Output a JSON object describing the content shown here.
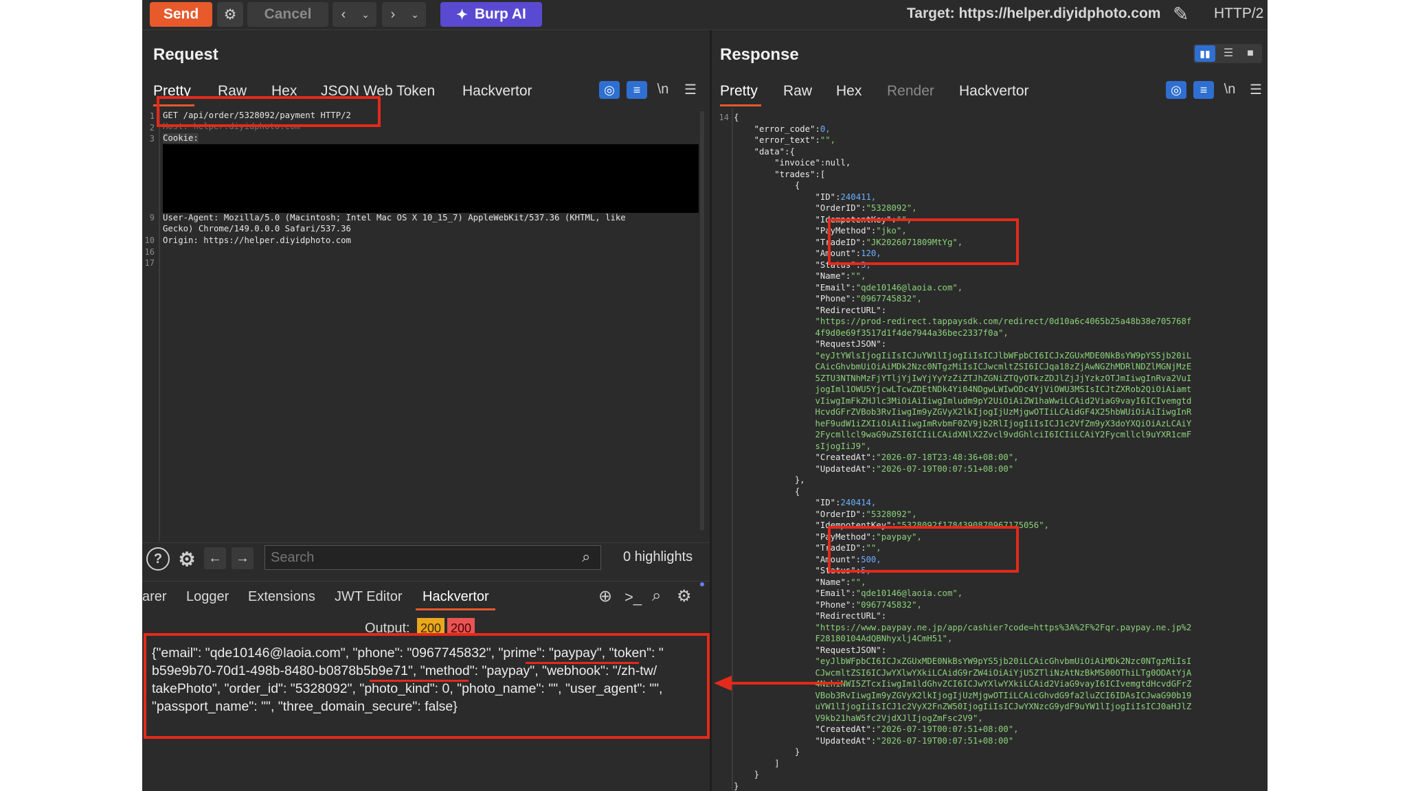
{
  "toolbar": {
    "send": "Send",
    "cancel": "Cancel",
    "burp_ai": "Burp AI",
    "target": "Target: https://helper.diyidphoto.com",
    "protocol": "HTTP/2"
  },
  "request": {
    "title": "Request",
    "tabs": [
      "Pretty",
      "Raw",
      "Hex",
      "JSON Web Token",
      "Hackvertor"
    ],
    "newline_toggle": "\\n",
    "line_numbers": [
      "1",
      "2",
      "3",
      "9",
      "",
      "10",
      "16",
      "17"
    ],
    "lines": {
      "l1": "GET /api/order/5328092/payment HTTP/2",
      "l2": "Host: helper.diyidphoto.com",
      "l3": "Cookie:",
      "l9a": "User-Agent: Mozilla/5.0 (Macintosh; Intel Mac OS X 10_15_7) AppleWebKit/537.36 (KHTML, like",
      "l9b": "Gecko) Chrome/149.0.0.0 Safari/537.36",
      "l10": "Origin: https://helper.diyidphoto.com"
    }
  },
  "search": {
    "placeholder": "Search",
    "highlights": "0 highlights"
  },
  "bottom_tabs": [
    "arer",
    "Logger",
    "Extensions",
    "JWT Editor",
    "Hackvertor"
  ],
  "output": {
    "label": "Output:",
    "badge1": "200",
    "badge2": "200",
    "lines": [
      "{\"email\": \"qde10146@laoia.com\", \"phone\": \"0967745832\", \"prime\": \"paypay\", \"token\": \"",
      "b59e9b70-70d1-498b-8480-b0878b5b9e71\", \"method\": \"paypay\", \"webhook\": \"/zh-tw/",
      "takePhoto\", \"order_id\": \"5328092\", \"photo_kind\": 0, \"photo_name\": \"\", \"user_agent\": \"\",",
      "\"passport_name\": \"\", \"three_domain_secure\": false}"
    ]
  },
  "response": {
    "title": "Response",
    "tabs": [
      "Pretty",
      "Raw",
      "Hex",
      "Render",
      "Hackvertor"
    ],
    "newline_toggle": "\\n",
    "first_line_number": "14",
    "json_lines": [
      {
        "t": "{",
        "c": "p"
      },
      {
        "t": "    \"error_code\":0,",
        "c": "k"
      },
      {
        "t": "    \"error_text\":\"\",",
        "c": "k"
      },
      {
        "t": "    \"data\":{",
        "c": "k"
      },
      {
        "t": "        \"invoice\":null,",
        "c": "k"
      },
      {
        "t": "        \"trades\":[",
        "c": "k"
      },
      {
        "t": "            {",
        "c": "p"
      },
      {
        "t": "                \"ID\":240411,",
        "c": "k"
      },
      {
        "t": "                \"OrderID\":\"5328092\",",
        "c": "k"
      },
      {
        "t": "                \"IdempotentKey\":\"\",",
        "c": "k"
      },
      {
        "t": "                \"PayMethod\":\"jko\",",
        "c": "k"
      },
      {
        "t": "                \"TradeID\":\"JK2026071809MtYg\",",
        "c": "k"
      },
      {
        "t": "                \"Amount\":120,",
        "c": "k"
      },
      {
        "t": "                \"Status\":3,",
        "c": "k"
      },
      {
        "t": "                \"Name\":\"\",",
        "c": "k"
      },
      {
        "t": "                \"Email\":\"qde10146@laoia.com\",",
        "c": "k"
      },
      {
        "t": "                \"Phone\":\"0967745832\",",
        "c": "k"
      },
      {
        "t": "                \"RedirectURL\":",
        "c": "k"
      },
      {
        "t": "                \"https://prod-redirect.tappaysdk.com/redirect/0d10a6c4065b25a48b38e705768f",
        "c": "s"
      },
      {
        "t": "                4f9d0e69f3517d1f4de7944a36bec2337f0a\",",
        "c": "s"
      },
      {
        "t": "                \"RequestJSON\":",
        "c": "k"
      },
      {
        "t": "                \"eyJtYWlsIjogIiIsICJuYW1lIjogIiIsICJlbWFpbCI6ICJxZGUxMDE0NkBsYW9pYS5jb20iL",
        "c": "s"
      },
      {
        "t": "                CAicGhvbmUiOiAiMDk2Nzc0NTgzMiIsICJwcmltZSI6ICJqa18zZjAwNGZhMDRlNDZlMGNjMzE",
        "c": "s"
      },
      {
        "t": "                5ZTU3NTNhMzFjYTljYjIwYjYyYzZiZTJhZGNiZTQyOTkzZDJlZjJjYzkzOTJmIiwgInRva2VuI",
        "c": "s"
      },
      {
        "t": "                jogIml1OWU5YjcwLTcwZDEtNDk4Yi04NDgwLWIwODc4YjViOWU3MSIsICJtZXRob2QiOiAiamt",
        "c": "s"
      },
      {
        "t": "                vIiwgImFkZHJlc3MiOiAiIiwgImludm9pY2UiOiAiZW1haWwiLCAid2ViaG9vayI6ICIvemgtd",
        "c": "s"
      },
      {
        "t": "                HcvdGFrZVBob3RvIiwgIm9yZGVyX2lkIjogIjUzMjgwOTIiLCAidGF4X25hbWUiOiAiIiwgInR",
        "c": "s"
      },
      {
        "t": "                heF9udW1iZXIiOiAiIiwgImRvbmF0ZV9jb2RlIjogIiIsICJ1c2VfZm9yX3doYXQiOiAzLCAiY",
        "c": "s"
      },
      {
        "t": "                2Fycmllcl9waG9uZSI6ICIiLCAidXNlX2Zvcl9vdGhlciI6ICIiLCAiY2Fycmllcl9uYXR1cmF",
        "c": "s"
      },
      {
        "t": "                sIjogIiJ9\",",
        "c": "s"
      },
      {
        "t": "                \"CreatedAt\":\"2026-07-18T23:48:36+08:00\",",
        "c": "k"
      },
      {
        "t": "                \"UpdatedAt\":\"2026-07-19T00:07:51+08:00\"",
        "c": "k"
      },
      {
        "t": "            },",
        "c": "p"
      },
      {
        "t": "            {",
        "c": "p"
      },
      {
        "t": "                \"ID\":240414,",
        "c": "k"
      },
      {
        "t": "                \"OrderID\":\"5328092\",",
        "c": "k"
      },
      {
        "t": "                \"IdempotentKey\":\"5328092f1784390870967175056\",",
        "c": "k"
      },
      {
        "t": "                \"PayMethod\":\"paypay\",",
        "c": "k"
      },
      {
        "t": "                \"TradeID\":\"\",",
        "c": "k"
      },
      {
        "t": "                \"Amount\":500,",
        "c": "k"
      },
      {
        "t": "                \"Status\":5,",
        "c": "k"
      },
      {
        "t": "                \"Name\":\"\",",
        "c": "k"
      },
      {
        "t": "                \"Email\":\"qde10146@laoia.com\",",
        "c": "k"
      },
      {
        "t": "                \"Phone\":\"0967745832\",",
        "c": "k"
      },
      {
        "t": "                \"RedirectURL\":",
        "c": "k"
      },
      {
        "t": "                \"https://www.paypay.ne.jp/app/cashier?code=https%3A%2F%2Fqr.paypay.ne.jp%2",
        "c": "s"
      },
      {
        "t": "                F28180104AdQBNhyxlj4CmH51\",",
        "c": "s"
      },
      {
        "t": "                \"RequestJSON\":",
        "c": "k"
      },
      {
        "t": "                \"eyJlbWFpbCI6ICJxZGUxMDE0NkBsYW9pYS5jb20iLCAicGhvbmUiOiAiMDk2Nzc0NTgzMiIsI",
        "c": "s"
      },
      {
        "t": "                CJwcmltZSI6ICJwYXlwYXkiLCAidG9rZW4iOiAiYjU5ZTliNzAtNzBkMS00OThiLTg0ODAtYjA",
        "c": "s"
      },
      {
        "t": "                4NzhiNWI5ZTcxIiwgIm1ldGhvZCI6ICJwYXlwYXkiLCAid2ViaG9vayI6ICIvemgtdHcvdGFrZ",
        "c": "s"
      },
      {
        "t": "                VBob3RvIiwgIm9yZGVyX2lkIjogIjUzMjgwOTIiLCAicGhvdG9fa2luZCI6IDAsICJwaG90b19",
        "c": "s"
      },
      {
        "t": "                uYW1lIjogIiIsICJ1c2VyX2FnZW50IjogIiIsICJwYXNzcG9ydF9uYW1lIjogIiIsICJ0aHJlZ",
        "c": "s"
      },
      {
        "t": "                V9kb21haW5fc2VjdXJlIjogZmFsc2V9\",",
        "c": "s"
      },
      {
        "t": "                \"CreatedAt\":\"2026-07-19T00:07:51+08:00\",",
        "c": "k"
      },
      {
        "t": "                \"UpdatedAt\":\"2026-07-19T00:07:51+08:00\"",
        "c": "k"
      },
      {
        "t": "            }",
        "c": "p"
      },
      {
        "t": "        ]",
        "c": "p"
      },
      {
        "t": "    }",
        "c": "p"
      },
      {
        "t": "}",
        "c": "p"
      }
    ]
  },
  "colors": {
    "send": "#e8592c",
    "burp_ai": "#5a4ad1",
    "annotation_red": "#e32a1b",
    "json_string": "#8bd27a",
    "json_number": "#6ab0ff"
  }
}
